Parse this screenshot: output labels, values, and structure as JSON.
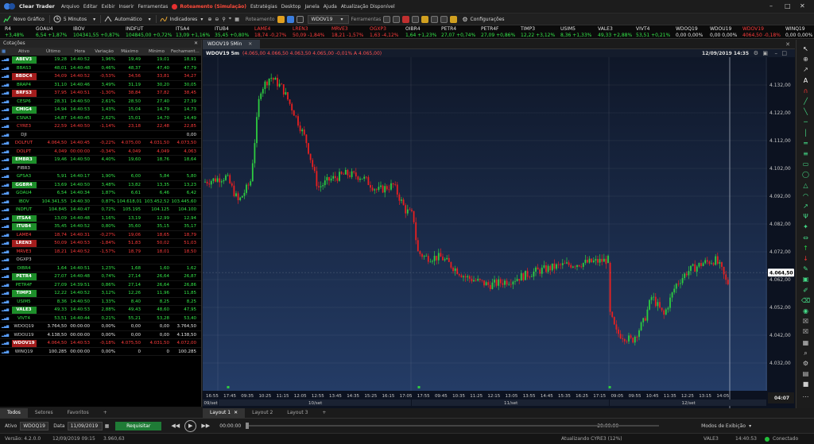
{
  "menu": {
    "app_title": "Clear Trader",
    "items": [
      "Arquivo",
      "Editar",
      "Exibir",
      "Inserir",
      "Ferramentas"
    ],
    "routing": "Roteamento (Simulação)",
    "items2": [
      "Estratégias",
      "Desktop",
      "Janela",
      "Ajuda",
      "Atualização Disponível"
    ]
  },
  "toolbar": {
    "new_chart": "Novo Gráfico",
    "interval": "5 Minutos",
    "auto": "Automático",
    "indicators": "Indicadores",
    "routing": "Roteamento",
    "symbol": "WDOV19",
    "tools": "Ferramentas",
    "settings": "Configurações"
  },
  "ticker": [
    {
      "sym": "R4",
      "val": "+3,48%",
      "dir": "up"
    },
    {
      "sym": "GOAU4",
      "val": "6,54 +1,87%",
      "dir": "up"
    },
    {
      "sym": "IBOV",
      "val": "104341,55 +0,87%",
      "dir": "up"
    },
    {
      "sym": "INDFUT",
      "val": "104845,00 +0,72%",
      "dir": "up"
    },
    {
      "sym": "ITSA4",
      "val": "13,09 +1,16%",
      "dir": "up"
    },
    {
      "sym": "ITUB4",
      "val": "35,45 +0,80%",
      "dir": "up"
    },
    {
      "sym": "LAME4",
      "val": "18,74 -0,27%",
      "dir": "down"
    },
    {
      "sym": "LREN3",
      "val": "50,09 -1,84%",
      "dir": "down"
    },
    {
      "sym": "MRVE3",
      "val": "18,21 -1,57%",
      "dir": "down"
    },
    {
      "sym": "OGXP3",
      "val": "1,63 -4,12%",
      "dir": "down"
    },
    {
      "sym": "OIBR4",
      "val": "1,64 +1,23%",
      "dir": "up"
    },
    {
      "sym": "PETR4",
      "val": "27,07 +0,74%",
      "dir": "up"
    },
    {
      "sym": "PETR4F",
      "val": "27,09 +0,86%",
      "dir": "up"
    },
    {
      "sym": "TIMP3",
      "val": "12,22 +3,12%",
      "dir": "up"
    },
    {
      "sym": "USIM5",
      "val": "8,36 +1,33%",
      "dir": "up"
    },
    {
      "sym": "VALE3",
      "val": "49,33 +2,88%",
      "dir": "up"
    },
    {
      "sym": "VIVT4",
      "val": "53,51 +0,21%",
      "dir": "up"
    },
    {
      "sym": "WDOQ19",
      "val": "0,00 0,00%",
      "dir": "flat"
    },
    {
      "sym": "WDOU19",
      "val": "0,00 0,00%",
      "dir": "flat"
    },
    {
      "sym": "WDOV19",
      "val": "4064,50 -0,18%",
      "dir": "down"
    },
    {
      "sym": "WINQ19",
      "val": "0,00 0,00%",
      "dir": "flat"
    }
  ],
  "quotes": {
    "title": "Cotações",
    "headers": [
      "Ativo",
      "Último",
      "Hora",
      "Variação",
      "Máximo",
      "Mínimo",
      "Fechament..."
    ],
    "rows": [
      {
        "sym": "ABEV3",
        "style": "chip-up",
        "last": "19,28",
        "time": "14:40:52",
        "var": "1,96%",
        "max": "19,49",
        "min": "19,01",
        "close": "18,91",
        "dir": "up"
      },
      {
        "sym": "BBAS3",
        "style": "up",
        "last": "48,01",
        "time": "14:40:48",
        "var": "0,46%",
        "max": "48,37",
        "min": "47,40",
        "close": "47,79",
        "dir": "up"
      },
      {
        "sym": "BBDC4",
        "style": "chip-down",
        "last": "34,09",
        "time": "14:40:52",
        "var": "-0,53%",
        "max": "34,56",
        "min": "33,81",
        "close": "34,27",
        "dir": "down"
      },
      {
        "sym": "BRAP4",
        "style": "up",
        "last": "31,10",
        "time": "14:40:46",
        "var": "3,49%",
        "max": "31,19",
        "min": "30,20",
        "close": "30,05",
        "dir": "up"
      },
      {
        "sym": "BRFS3",
        "style": "chip-down",
        "last": "37,95",
        "time": "14:40:51",
        "var": "-1,30%",
        "max": "38,84",
        "min": "37,82",
        "close": "38,45",
        "dir": "down"
      },
      {
        "sym": "CESP6",
        "style": "up",
        "last": "28,31",
        "time": "14:40:50",
        "var": "2,61%",
        "max": "28,50",
        "min": "27,40",
        "close": "27,39",
        "dir": "up"
      },
      {
        "sym": "CMIG4",
        "style": "chip-up",
        "last": "14,94",
        "time": "14:40:53",
        "var": "1,43%",
        "max": "15,04",
        "min": "14,79",
        "close": "14,73",
        "dir": "up"
      },
      {
        "sym": "CSNA3",
        "style": "up",
        "last": "14,87",
        "time": "14:40:45",
        "var": "2,62%",
        "max": "15,01",
        "min": "14,70",
        "close": "14,49",
        "dir": "up"
      },
      {
        "sym": "CYRE3",
        "style": "down",
        "last": "22,59",
        "time": "14:40:50",
        "var": "-1,14%",
        "max": "23,18",
        "min": "22,48",
        "close": "22,85",
        "dir": "down"
      },
      {
        "sym": "DJI",
        "style": "plain",
        "last": "",
        "time": "",
        "var": "",
        "max": "",
        "min": "",
        "close": "0,00",
        "dir": "flat"
      },
      {
        "sym": "DOLFUT",
        "style": "down",
        "last": "4.064,50",
        "time": "14:40:45",
        "var": "-0,22%",
        "max": "4.075,00",
        "min": "4.031,50",
        "close": "4.073,50",
        "dir": "down"
      },
      {
        "sym": "DOLPT",
        "style": "down",
        "last": "4,049",
        "time": "00:00:00",
        "var": "-0,34%",
        "max": "4,049",
        "min": "4,049",
        "close": "4,063",
        "dir": "down"
      },
      {
        "sym": "EMBR3",
        "style": "chip-up",
        "last": "19,46",
        "time": "14:40:50",
        "var": "4,40%",
        "max": "19,60",
        "min": "18,76",
        "close": "18,64",
        "dir": "up"
      },
      {
        "sym": "FIBR3",
        "style": "plain",
        "last": "",
        "time": "",
        "var": "",
        "max": "",
        "min": "",
        "close": "",
        "dir": "flat"
      },
      {
        "sym": "GFSA3",
        "style": "up",
        "last": "5,91",
        "time": "14:40:17",
        "var": "1,90%",
        "max": "6,00",
        "min": "5,84",
        "close": "5,80",
        "dir": "up"
      },
      {
        "sym": "GGBR4",
        "style": "chip-up",
        "last": "13,69",
        "time": "14:40:50",
        "var": "3,48%",
        "max": "13,82",
        "min": "13,35",
        "close": "13,23",
        "dir": "up"
      },
      {
        "sym": "GOAU4",
        "style": "up",
        "last": "6,54",
        "time": "14:40:34",
        "var": "1,87%",
        "max": "6,61",
        "min": "6,46",
        "close": "6,42",
        "dir": "up"
      },
      {
        "sym": "IBOV",
        "style": "up",
        "last": "104.341,55",
        "time": "14:40:30",
        "var": "0,87%",
        "max": "104.618,01",
        "min": "103.452,52",
        "close": "103.445,60",
        "dir": "up"
      },
      {
        "sym": "INDFUT",
        "style": "up",
        "last": "104.845",
        "time": "14:40:47",
        "var": "0,72%",
        "max": "105.195",
        "min": "104.125",
        "close": "104.100",
        "dir": "up"
      },
      {
        "sym": "ITSA4",
        "style": "chip-up",
        "last": "13,09",
        "time": "14:40:48",
        "var": "1,16%",
        "max": "13,19",
        "min": "12,99",
        "close": "12,94",
        "dir": "up"
      },
      {
        "sym": "ITUB4",
        "style": "chip-up",
        "last": "35,45",
        "time": "14:40:52",
        "var": "0,80%",
        "max": "35,60",
        "min": "35,15",
        "close": "35,17",
        "dir": "up"
      },
      {
        "sym": "LAME4",
        "style": "down",
        "last": "18,74",
        "time": "14:40:31",
        "var": "-0,27%",
        "max": "19,06",
        "min": "18,65",
        "close": "18,79",
        "dir": "down"
      },
      {
        "sym": "LREN3",
        "style": "chip-down",
        "last": "50,09",
        "time": "14:40:53",
        "var": "-1,84%",
        "max": "51,83",
        "min": "50,02",
        "close": "51,03",
        "dir": "down"
      },
      {
        "sym": "MRVE3",
        "style": "down",
        "last": "18,21",
        "time": "14:40:52",
        "var": "-1,57%",
        "max": "18,79",
        "min": "18,01",
        "close": "18,50",
        "dir": "down"
      },
      {
        "sym": "OGXP3",
        "style": "plain",
        "last": "",
        "time": "",
        "var": "",
        "max": "",
        "min": "",
        "close": "",
        "dir": "flat"
      },
      {
        "sym": "OIBR4",
        "style": "up",
        "last": "1,64",
        "time": "14:40:51",
        "var": "1,23%",
        "max": "1,68",
        "min": "1,60",
        "close": "1,62",
        "dir": "up"
      },
      {
        "sym": "PETR4",
        "style": "chip-up",
        "last": "27,07",
        "time": "14:40:48",
        "var": "0,74%",
        "max": "27,14",
        "min": "26,64",
        "close": "26,87",
        "dir": "up"
      },
      {
        "sym": "PETR4F",
        "style": "up",
        "last": "27,09",
        "time": "14:39:51",
        "var": "0,86%",
        "max": "27,14",
        "min": "26,64",
        "close": "26,86",
        "dir": "up"
      },
      {
        "sym": "TIMP3",
        "style": "chip-up",
        "last": "12,22",
        "time": "14:40:52",
        "var": "3,12%",
        "max": "12,26",
        "min": "11,96",
        "close": "11,85",
        "dir": "up"
      },
      {
        "sym": "USIM5",
        "style": "up",
        "last": "8,36",
        "time": "14:40:50",
        "var": "1,33%",
        "max": "8,40",
        "min": "8,25",
        "close": "8,25",
        "dir": "up"
      },
      {
        "sym": "VALE3",
        "style": "chip-up",
        "last": "49,33",
        "time": "14:40:53",
        "var": "2,88%",
        "max": "49,43",
        "min": "48,60",
        "close": "47,95",
        "dir": "up"
      },
      {
        "sym": "VIVT4",
        "style": "up",
        "last": "53,51",
        "time": "14:40:44",
        "var": "0,21%",
        "max": "55,21",
        "min": "53,28",
        "close": "53,40",
        "dir": "up"
      },
      {
        "sym": "WDOQ19",
        "style": "plain",
        "last": "3.764,50",
        "time": "00:00:00",
        "var": "0,00%",
        "max": "0,00",
        "min": "0,00",
        "close": "3.764,50",
        "dir": "flat"
      },
      {
        "sym": "WDOU19",
        "style": "plain",
        "last": "4.138,50",
        "time": "00:00:00",
        "var": "0,00%",
        "max": "0,00",
        "min": "0,00",
        "close": "4.138,50",
        "dir": "flat"
      },
      {
        "sym": "WDOV19",
        "style": "chip-down",
        "last": "4.064,50",
        "time": "14:40:53",
        "var": "-0,18%",
        "max": "4.075,50",
        "min": "4.031,50",
        "close": "4.072,00",
        "dir": "down"
      },
      {
        "sym": "WINQ19",
        "style": "plain",
        "last": "100.285",
        "time": "00:00:00",
        "var": "0,00%",
        "max": "0",
        "min": "0",
        "close": "100.285",
        "dir": "flat"
      }
    ],
    "tabs": [
      "Todos",
      "Setores",
      "Favoritos",
      "+"
    ]
  },
  "chart": {
    "tab_label": "WDOV19 5Min",
    "title": "WDOV19 5m",
    "ohlc": "(4.065,00 4.066,50 4.063,50 4.065,00 -0,01% A 4.065,00)",
    "datetime": "12/09/2019 14:35",
    "price_labels": [
      "4.132,00",
      "4.122,00",
      "4.112,00",
      "4.102,00",
      "4.092,00",
      "4.082,00",
      "4.072,00",
      "4.062,00",
      "4.052,00",
      "4.042,00",
      "4.032,00"
    ],
    "current_price": "4.064,50",
    "time_labels": [
      "16:55",
      "17:45",
      "09:35",
      "10:25",
      "11:15",
      "12:05",
      "12:55",
      "13:45",
      "14:35",
      "15:25",
      "16:15",
      "17:05",
      "17:55",
      "09:45",
      "10:35",
      "11:25",
      "12:15",
      "13:05",
      "13:55",
      "14:45",
      "15:35",
      "16:25",
      "17:15",
      "09:05",
      "09:55",
      "10:45",
      "11:35",
      "12:25",
      "13:15",
      "14:05"
    ],
    "date_labels": [
      "09/set",
      "10/set",
      "11/set",
      "12/set"
    ],
    "countdown": "04:07",
    "up_color": "#2ecc40",
    "down_color": "#e82020"
  },
  "layouts": [
    "Layout 1",
    "Layout 2",
    "Layout 3",
    "+"
  ],
  "replay": {
    "ativo_label": "Ativo",
    "ativo_value": "WDOQ19",
    "data_label": "Data",
    "data_value": "11/09/2019",
    "request_button": "Requisitar",
    "time_start": "00:00:00",
    "time_end": "20:00:00",
    "mode_label": "Modos de Exibição"
  },
  "status": {
    "version": "Versão: 4.2.0.0",
    "datetime": "12/09/2019 09:15",
    "value": "3.960,63",
    "update": "Atualizando CYRE3 (12%)",
    "asset": "VALE3",
    "clock": "14:40:53",
    "connection": "Conectado"
  }
}
